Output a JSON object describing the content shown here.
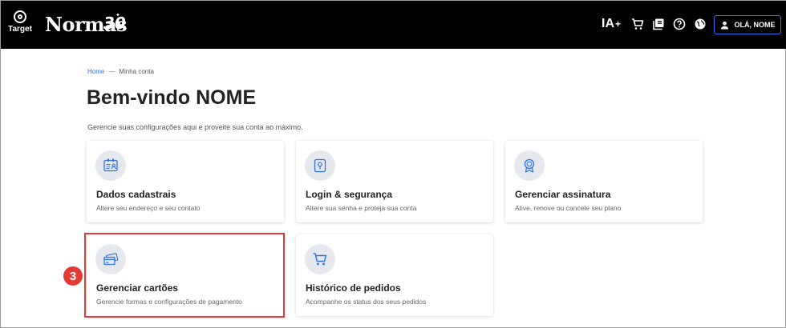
{
  "header": {
    "brand_target": "Target",
    "brand_normas": "Normas",
    "brand_30": "30",
    "ia_label": "IA",
    "ia_plus": "+",
    "user_button": "OLÁ, NOME",
    "icons": [
      "cart-icon",
      "library-icon",
      "help-icon",
      "globe-icon",
      "user-icon"
    ]
  },
  "breadcrumb": {
    "home": "Home",
    "separator": "—",
    "current": "Minha conta"
  },
  "page": {
    "title": "Bem-vindo NOME",
    "subtitle": "Gerencie suas configurações aqui e proveite sua conta ao máximo."
  },
  "cards": [
    {
      "title": "Dados cadastrais",
      "desc": "Altere seu endereço e seu contato",
      "icon": "id-card-icon"
    },
    {
      "title": "Login & segurança",
      "desc": "Altere sua senha e proteja sua conta",
      "icon": "lock-icon"
    },
    {
      "title": "Gerenciar assinatura",
      "desc": "Ative, renove ou cancele seu plano",
      "icon": "award-icon"
    },
    {
      "title": "Gerenciar cartões",
      "desc": "Gerencie formas e configurações de pagamento",
      "icon": "credit-card-icon"
    },
    {
      "title": "Histórico de pedidos",
      "desc": "Acompanhe os status dos seus pedidos",
      "icon": "cart-icon"
    }
  ],
  "annotation": {
    "step": "3"
  },
  "colors": {
    "accent": "#2f73f0",
    "highlight": "#e23a34",
    "header_bg": "#000000"
  }
}
